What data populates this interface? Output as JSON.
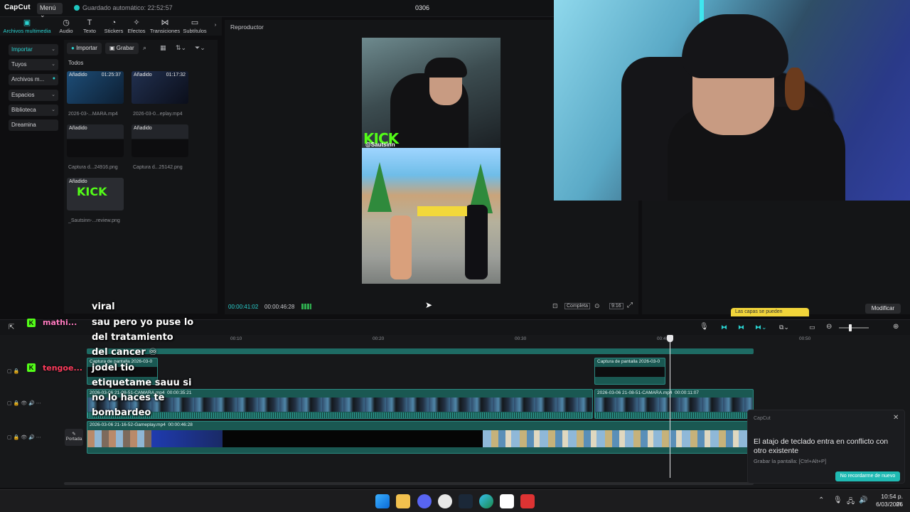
{
  "app": {
    "logo": "CapCut",
    "menu_label": "Menú",
    "autosave": "Guardado automático: 22:52:57",
    "project_title": "0306"
  },
  "tool_tabs": [
    {
      "label": "Archivos multimedia",
      "icon": "media-icon"
    },
    {
      "label": "Audio",
      "icon": "audio-icon"
    },
    {
      "label": "Texto",
      "icon": "text-icon"
    },
    {
      "label": "Stickers",
      "icon": "sticker-icon"
    },
    {
      "label": "Efectos",
      "icon": "effects-icon"
    },
    {
      "label": "Transiciones",
      "icon": "transitions-icon"
    },
    {
      "label": "Subtítulos",
      "icon": "subtitles-icon"
    }
  ],
  "left_nav": [
    {
      "label": "Importar"
    },
    {
      "label": "Tuyos"
    },
    {
      "label": "Archivos m..."
    },
    {
      "label": "Espacios"
    },
    {
      "label": "Biblioteca"
    },
    {
      "label": "Dreamina"
    }
  ],
  "media": {
    "import_label": "Importar",
    "record_label": "Grabar",
    "all_label": "Todos",
    "items": [
      {
        "badge": "Añadido",
        "duration": "01:25:37",
        "name": "2026-03-...MARA.mp4"
      },
      {
        "badge": "Añadido",
        "duration": "01:17:32",
        "name": "2026-03-0...eplay.mp4"
      },
      {
        "badge": "Añadido",
        "duration": "",
        "name": "Captura d...24916.png"
      },
      {
        "badge": "Añadido",
        "duration": "",
        "name": "Captura d...25142.png"
      },
      {
        "badge": "Añadido",
        "duration": "",
        "name": "_Sautsinn-...review.png"
      }
    ]
  },
  "player": {
    "title": "Reproductor",
    "time_current": "00:00:41:02",
    "time_total": "00:00:46:28",
    "full_label": "Completa",
    "ratio_label": "9:16",
    "kick_logo": "KICK",
    "kick_user": "@Sautsinn"
  },
  "right": {
    "modify_label": "Modificar",
    "layers_tip": "Las capas se pueden"
  },
  "timeline": {
    "ticks": [
      "00:10",
      "00:20",
      "00:30",
      "00:40",
      "00:50"
    ],
    "clips": {
      "cap1": "Captura de pantalla 2026-03-0",
      "cap2": "Captura de pantalla 2026-03-0",
      "cam1_name": "2026-03-06 21-08-51-CAMARA.mp4",
      "cam1_dur": "00:00:35:21",
      "cam2_name": "2026-03-06 21-08-51-CAMARA.mp4",
      "cam2_dur": "00:00:11:07",
      "game_name": "2026-03-06 21-16-52-Gameplay.mp4",
      "game_dur": "00:00:46:28"
    },
    "cover_label": "Portada"
  },
  "chat": {
    "lines": [
      "viral",
      "sau pero yo puse lo",
      "del tratamiento",
      "del cancer ♾",
      "jodel tio",
      "etiquetame sauu si",
      "no lo haces te",
      "bombardeo"
    ],
    "users": [
      "mathi...",
      "tengoe..."
    ]
  },
  "toast": {
    "app": "CapCut",
    "message": "El atajo de teclado entra en conflicto con otro existente",
    "sub": "Grabar la pantalla: [Ctrl+Alt+P]",
    "button": "No recordarme de nuevo"
  },
  "taskbar": {
    "time": "10:54 p. m.",
    "date": "6/03/2026"
  },
  "colors": {
    "accent": "#2ad1cf",
    "kick_green": "#53fc18",
    "track": "#1a5852"
  }
}
